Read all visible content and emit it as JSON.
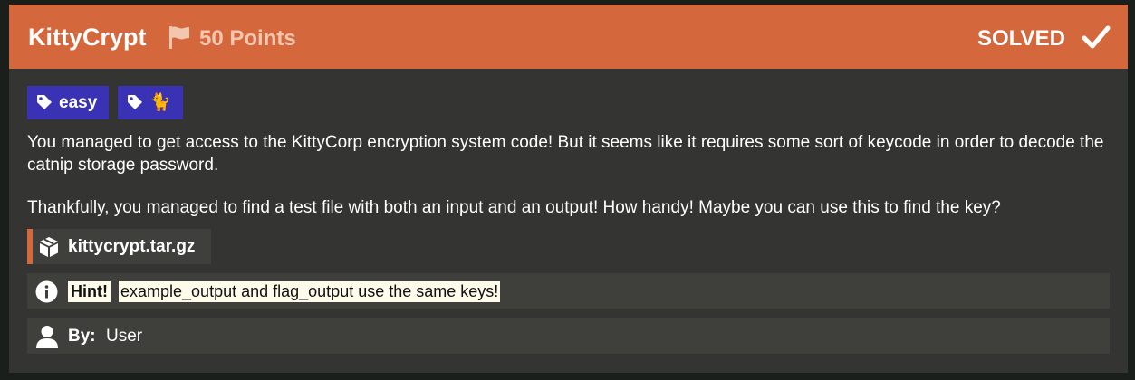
{
  "challenge": {
    "title": "KittyCrypt",
    "points": "50 Points",
    "status": "SOLVED",
    "header_color": "#d4683c",
    "flag_icon": "flag-icon",
    "status_icon": "check-icon"
  },
  "tags": [
    {
      "label": "easy",
      "icon": "tag-icon",
      "color": "#3a32b4"
    },
    {
      "label": "🐈",
      "icon": "tag-icon",
      "color": "#3a32b4"
    }
  ],
  "description": {
    "paragraph1": "You managed to get access to the KittyCorp encryption system code! But it seems like it requires some sort of keycode in order to decode the catnip storage password.",
    "paragraph2": "Thankfully, you managed to find a test file with both an input and an output! How handy! Maybe you can use this to find the key?"
  },
  "file": {
    "name": "kittycrypt.tar.gz",
    "icon": "package-icon"
  },
  "hint": {
    "label": "Hint!",
    "text": "example_output and flag_output use the same keys!",
    "icon": "info-icon"
  },
  "author": {
    "label": "By:",
    "name": "User",
    "icon": "user-icon"
  }
}
